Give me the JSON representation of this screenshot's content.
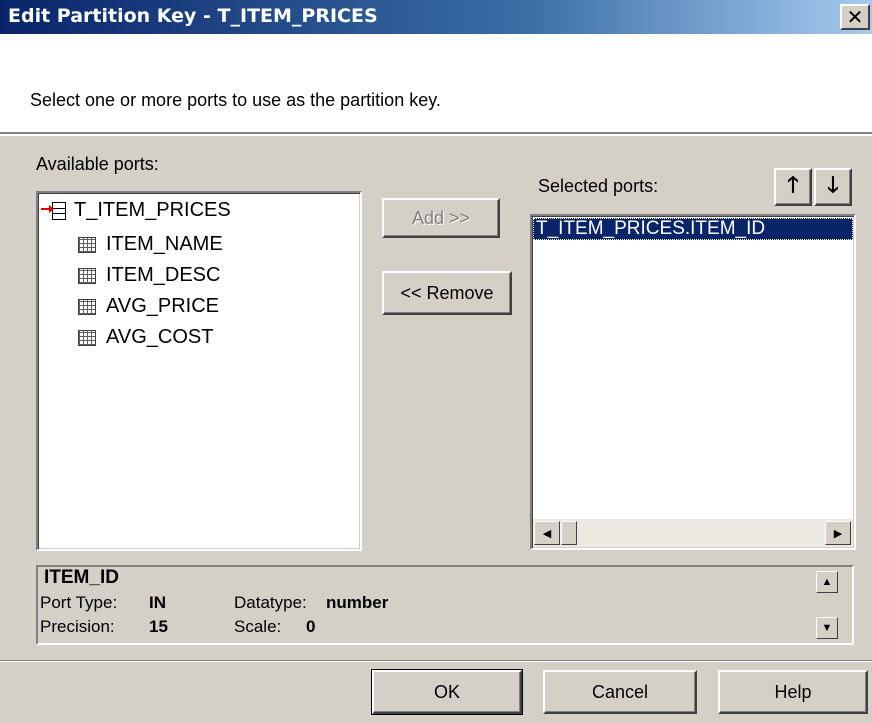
{
  "window": {
    "title": "Edit Partition Key - T_ITEM_PRICES",
    "close_label": "✕"
  },
  "instructions": "Select one or more ports to use as the partition key.",
  "available": {
    "label": "Available ports:",
    "root": "T_ITEM_PRICES",
    "ports": [
      "ITEM_NAME",
      "ITEM_DESC",
      "AVG_PRICE",
      "AVG_COST"
    ]
  },
  "buttons": {
    "add": "Add >>",
    "remove": "<< Remove",
    "ok": "OK",
    "cancel": "Cancel",
    "help": "Help"
  },
  "selected": {
    "label": "Selected ports:",
    "move_up_icon": "up-arrow-icon",
    "move_down_icon": "down-arrow-icon",
    "items": [
      "T_ITEM_PRICES.ITEM_ID"
    ]
  },
  "details": {
    "name": "ITEM_ID",
    "port_type_label": "Port Type:",
    "port_type_value": "IN",
    "datatype_label": "Datatype:",
    "datatype_value": "number",
    "precision_label": "Precision:",
    "precision_value": "15",
    "scale_label": "Scale:",
    "scale_value": "0"
  },
  "colors": {
    "title_bar": "#0a246a",
    "selection": "#0a246a",
    "dialog_bg": "#d4d0c8"
  }
}
